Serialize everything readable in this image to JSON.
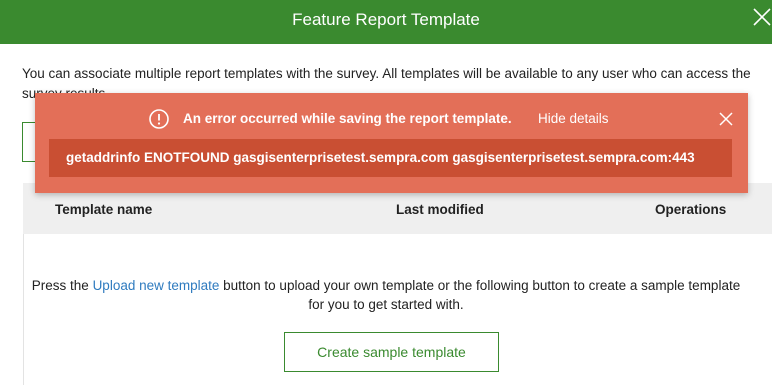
{
  "dialog": {
    "title": "Feature Report Template",
    "intro": "You can associate multiple report templates with the survey. All templates will be available to any user who can access the survey results.",
    "table": {
      "columns": [
        "Template name",
        "Last modified",
        "Operations"
      ]
    },
    "empty_state": {
      "prefix": "Press the ",
      "link": "Upload new template",
      "suffix_line1": " button to upload your own template or the following button to create a sample template",
      "line2": "for you to get started with."
    },
    "create_button": "Create sample template"
  },
  "error": {
    "message": "An error occurred while saving the report template.",
    "hide_details": "Hide details",
    "details": "getaddrinfo ENOTFOUND gasgisenterprisetest.sempra.com gasgisenterprisetest.sempra.com:443"
  },
  "colors": {
    "header": "#3a8a2f",
    "error_bg": "#e36f58",
    "error_detail_bg": "#c94f33",
    "link": "#2f7bbf"
  },
  "icons": {
    "close": "close-icon",
    "error": "exclamation-circle-icon",
    "error_close": "close-icon"
  }
}
